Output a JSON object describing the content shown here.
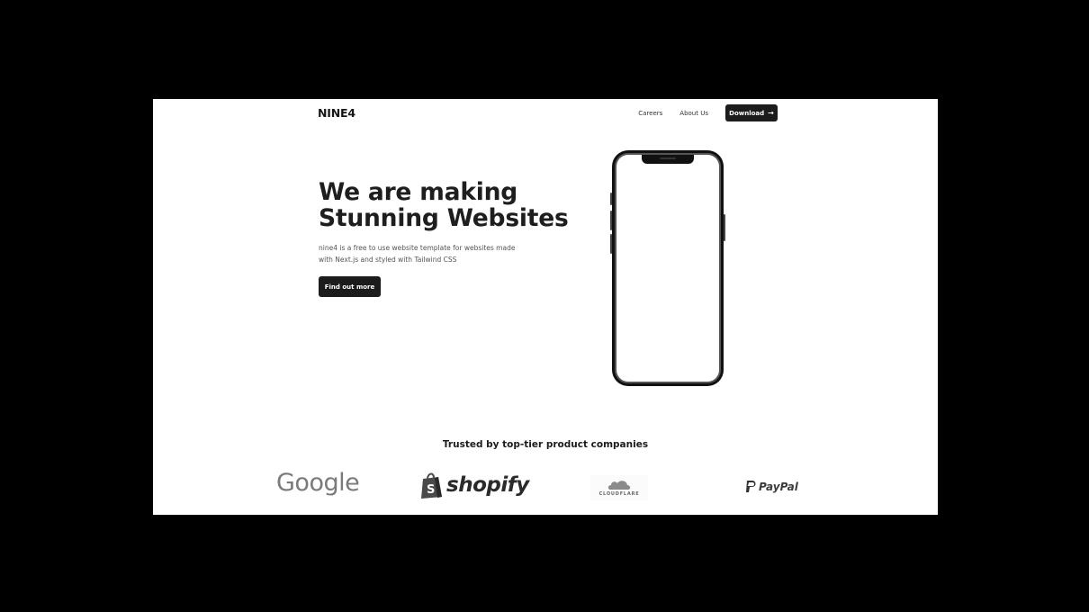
{
  "header": {
    "logo": "NINE4",
    "nav": [
      "Careers",
      "About Us"
    ],
    "download_label": "Download",
    "download_icon": "arrow-right-icon"
  },
  "hero": {
    "headline_line1": "We are making",
    "headline_line2": "Stunning Websites",
    "subtext_line1": "nine4 is a free to use website template for websites made",
    "subtext_line2": "with Next.js and styled with Tailwind CSS",
    "cta_label": "Find out more",
    "phone_icon": "smartphone-mockup"
  },
  "trusted": {
    "title": "Trusted by top-tier product companies",
    "brands": [
      {
        "name": "Google",
        "icon": "google-logo"
      },
      {
        "name": "shopify",
        "icon": "shopify-bag-logo"
      },
      {
        "name": "CLOUDFLARE",
        "icon": "cloudflare-cloud-logo"
      },
      {
        "name": "PayPal",
        "icon": "paypal-p-logo"
      }
    ]
  },
  "colors": {
    "backdrop": "#000000",
    "page_bg": "#ffffff",
    "button_dark": "#1c1c1c",
    "text_dark": "#1e1e1e"
  }
}
